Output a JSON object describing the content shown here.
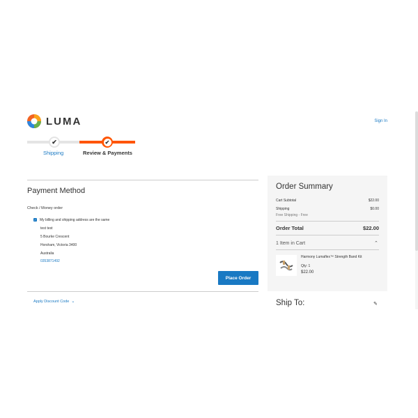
{
  "header": {
    "logo_text": "LUMA",
    "signin_label": "Sign In"
  },
  "progress": {
    "steps": [
      {
        "label": "Shipping",
        "state": "complete"
      },
      {
        "label": "Review & Payments",
        "state": "active"
      }
    ],
    "check_glyph": "✔"
  },
  "payment": {
    "title": "Payment Method",
    "method_label": "Check / Money order",
    "same_address_label": "My billing and shipping address are the same",
    "same_address_checked": true,
    "address": {
      "name": "test test",
      "street": "5 Bourke Crescent",
      "city": "Horsham, Victoria 3400",
      "country": "Australia",
      "phone": "0353871492"
    },
    "place_order_label": "Place Order",
    "discount_label": "Apply Discount Code",
    "discount_chevron": "⌄"
  },
  "summary": {
    "title": "Order Summary",
    "cart_subtotal_label": "Cart Subtotal",
    "cart_subtotal_value": "$22.00",
    "shipping_label": "Shipping",
    "shipping_value": "$0.00",
    "shipping_method": "Free Shipping - Free",
    "order_total_label": "Order Total",
    "order_total_value": "$22.00",
    "items_label": "1 Item in Cart",
    "items_chevron": "⌃",
    "item": {
      "name": "Harmony Lumaflex™ Strength Band Kit",
      "qty": "Qty: 1",
      "price": "$22.00"
    },
    "ship_to_label": "Ship To:",
    "edit_glyph": "✎"
  },
  "colors": {
    "accent_blue": "#1979c3",
    "accent_orange": "#ff5501",
    "summary_bg": "#f5f5f5"
  },
  "icons": [
    "luma-logo-icon",
    "check-icon",
    "chevron-down-icon",
    "chevron-up-icon",
    "pencil-icon"
  ]
}
